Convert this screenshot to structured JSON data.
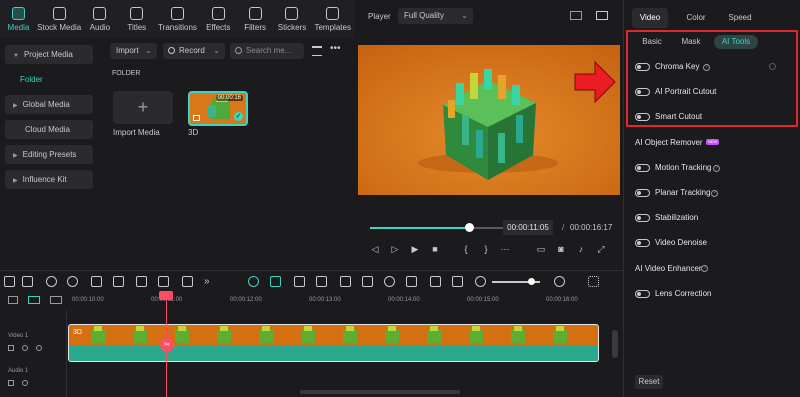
{
  "media_toolbar": {
    "items": [
      {
        "label": "Media",
        "icon": "media-icon"
      },
      {
        "label": "Stock Media",
        "icon": "stock-media-icon"
      },
      {
        "label": "Audio",
        "icon": "music-note-icon"
      },
      {
        "label": "Titles",
        "icon": "text-t-icon"
      },
      {
        "label": "Transitions",
        "icon": "transitions-icon"
      },
      {
        "label": "Effects",
        "icon": "effects-sparkle-icon"
      },
      {
        "label": "Filters",
        "icon": "filters-icon"
      },
      {
        "label": "Stickers",
        "icon": "stickers-icon"
      },
      {
        "label": "Templates",
        "icon": "templates-icon"
      }
    ]
  },
  "left_panel": {
    "items": [
      {
        "label": "Project Media"
      },
      {
        "label": "Folder"
      },
      {
        "label": "Global Media"
      },
      {
        "label": "Cloud Media"
      },
      {
        "label": "Editing Presets"
      },
      {
        "label": "Influence Kit"
      }
    ]
  },
  "media_area": {
    "import_label": "Import",
    "record_label": "Record",
    "search_placeholder": "Search me...",
    "folder_heading": "FOLDER",
    "import_media_label": "Import Media",
    "clip_duration": "00:00:16",
    "clip_name": "3D"
  },
  "player": {
    "title": "Player",
    "quality": "Full Quality",
    "current_time": "00:00:11:05",
    "separator": "/",
    "total_time": "00:00:16:17",
    "progress": 0.62
  },
  "right_panel": {
    "tabs": [
      "Video",
      "Color",
      "Speed"
    ],
    "sub_tabs": [
      "Basic",
      "Mask",
      "AI Tools"
    ],
    "toggles": [
      {
        "label": "Chroma Key"
      },
      {
        "label": "AI Portrait Cutout"
      },
      {
        "label": "Smart Cutout"
      },
      {
        "label": "Motion Tracking"
      },
      {
        "label": "Planar Tracking"
      },
      {
        "label": "Stabilization"
      },
      {
        "label": "Video Denoise"
      },
      {
        "label": "Lens Correction"
      }
    ],
    "section_object_remover": "AI Object Remover",
    "new_badge": "NEW",
    "section_enhancer": "AI Video Enhancer",
    "reset_label": "Reset"
  },
  "timeline": {
    "ticks": [
      "00:00:10:00",
      "00:00:11:00",
      "00:00:12:00",
      "00:00:13:00",
      "00:00:14:00",
      "00:00:15:00",
      "00:00:16:00"
    ],
    "track_video": "Video 1",
    "track_audio": "Audio 1",
    "clip_label": "3D"
  },
  "colors": {
    "accent": "#3ad6c1",
    "preview_orange": "#d46f12",
    "highlight_red": "#e0262f",
    "playhead": "#ff4d63"
  }
}
